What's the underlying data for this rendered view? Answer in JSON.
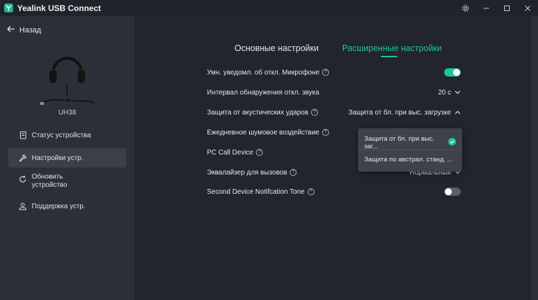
{
  "app": {
    "title": "Yealink USB Connect"
  },
  "sidebar": {
    "back_label": "Назад",
    "device_name": "UH38",
    "items": [
      {
        "label": "Статус устройства",
        "icon": "document-icon",
        "active": false
      },
      {
        "label": "Настройки устр.",
        "icon": "wrench-icon",
        "active": true
      },
      {
        "label": "Обновить устройство",
        "icon": "refresh-icon",
        "active": false
      },
      {
        "label": "Поддержка устр.",
        "icon": "support-icon",
        "active": false
      }
    ]
  },
  "tabs": {
    "basic": "Основные настройки",
    "advanced": "Расширенные настройки",
    "active": "advanced"
  },
  "settings": {
    "mic_notify": {
      "label": "Умн. уведомл. об откл. Микрофоне",
      "state": "on"
    },
    "silence_interval": {
      "label": "Интервал обнаружения откл. звука",
      "value": "20 с"
    },
    "acoustic_shock": {
      "label": "Защита от акустических ударов",
      "value": "Защита от бл. при выс. загрузке"
    },
    "daily_noise": {
      "label": "Ежедневное шумовое воздействие"
    },
    "pc_call_device": {
      "label": "PC Call Device"
    },
    "equalizer": {
      "label": "Эквалайзер для вызовов",
      "value": "Нормальный"
    },
    "second_device_tone": {
      "label": "Second Device Notifcation Tone",
      "state": "off"
    }
  },
  "dropdown": {
    "options": [
      {
        "label": "Защита от бл. при выс. заг...",
        "selected": true
      },
      {
        "label": "Защита по австрал. станд. ...",
        "selected": false
      }
    ]
  },
  "colors": {
    "accent": "#21c49a",
    "background": "#22252c",
    "sidebar": "#2b2f38"
  }
}
